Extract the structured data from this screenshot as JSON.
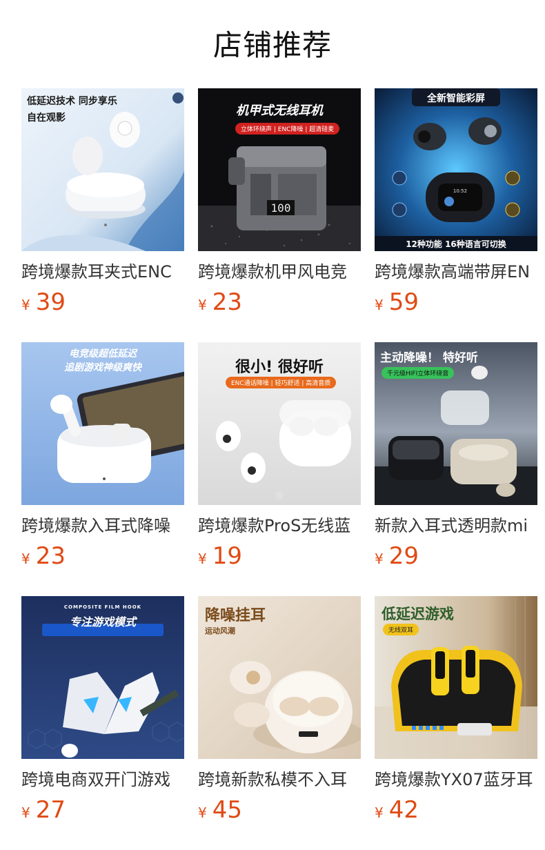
{
  "header": {
    "title": "店铺推荐"
  },
  "currency_symbol": "¥",
  "colors": {
    "price": "#e04a14",
    "title": "#111111",
    "name": "#333333"
  },
  "products": [
    {
      "name": "跨境爆款耳夹式ENC",
      "price": "39",
      "overlay": {
        "headline": "低延迟技术 同步享乐",
        "sub": "自在观影"
      }
    },
    {
      "name": "跨境爆款机甲风电竞",
      "price": "23",
      "overlay": {
        "headline": "机甲式无线耳机",
        "tag": "立体环绕声 | ENC降噪 | 超清硅麦",
        "display": "100"
      }
    },
    {
      "name": "跨境爆款高端带屏EN",
      "price": "59",
      "overlay": {
        "headline": "全新智能彩屏",
        "footer": "12种功能  16种语言可切换",
        "screen": "10:52"
      }
    },
    {
      "name": "跨境爆款入耳式降噪",
      "price": "23",
      "overlay": {
        "headline": "电竞级超低延迟",
        "sub": "追剧游戏神级爽快"
      }
    },
    {
      "name": "跨境爆款ProS无线蓝",
      "price": "19",
      "overlay": {
        "headline": "很小! 很好听",
        "tag": "ENC通话降噪 | 轻巧舒适 | 高清音质"
      }
    },
    {
      "name": "新款入耳式透明款mi",
      "price": "29",
      "overlay": {
        "headline": "主动降噪！ 特好听",
        "tag": "千元级HIFI立体环绕音"
      }
    },
    {
      "name": "跨境电商双开门游戏",
      "price": "27",
      "overlay": {
        "small": "COMPOSITE FILM HOOK",
        "headline": "专注游戏模式"
      }
    },
    {
      "name": "跨境新款私模不入耳",
      "price": "45",
      "overlay": {
        "headline": "降噪挂耳",
        "sub": "运动风潮"
      }
    },
    {
      "name": "跨境爆款YX07蓝牙耳",
      "price": "42",
      "overlay": {
        "headline": "低延迟游戏",
        "tag": "无线双耳"
      }
    }
  ]
}
